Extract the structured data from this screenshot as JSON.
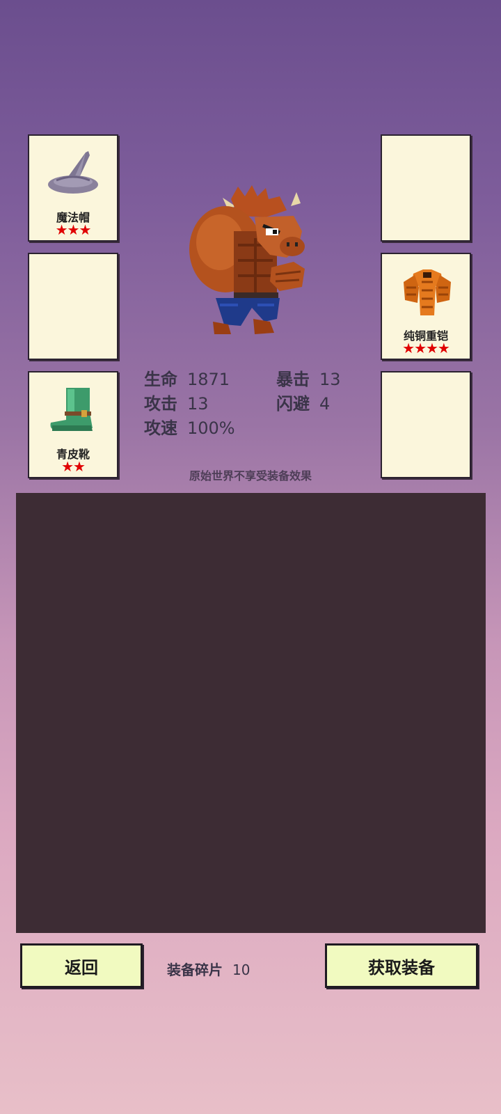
{
  "slots": {
    "left_1": {
      "name": "魔法帽",
      "stars": "★★★",
      "icon": "wizard-hat-icon"
    },
    "left_2": {
      "empty": true
    },
    "left_3": {
      "name": "青皮靴",
      "stars": "★★",
      "icon": "green-leather-boot-icon"
    },
    "right_1": {
      "empty": true
    },
    "right_2": {
      "name": "纯铜重铠",
      "stars": "★★★★",
      "icon": "copper-heavy-armor-icon"
    },
    "right_3": {
      "empty": true
    }
  },
  "hero": {
    "icon": "minotaur-hero-sprite"
  },
  "stats": {
    "hp": {
      "label": "生命",
      "value": "1871"
    },
    "atk": {
      "label": "攻击",
      "value": "13"
    },
    "spd": {
      "label": "攻速",
      "value": "100%"
    },
    "crit": {
      "label": "暴击",
      "value": "13"
    },
    "dodge": {
      "label": "闪避",
      "value": "4"
    }
  },
  "note": "原始世界不享受装备效果",
  "footer": {
    "back_label": "返回",
    "fragments_label": "装备碎片",
    "fragments_value": "10",
    "get_label": "获取装备"
  },
  "colors": {
    "star": "#e00000",
    "card_bg": "#fbf6dc",
    "button_bg": "#f1fac0",
    "panel_bg": "#3d2c34"
  }
}
